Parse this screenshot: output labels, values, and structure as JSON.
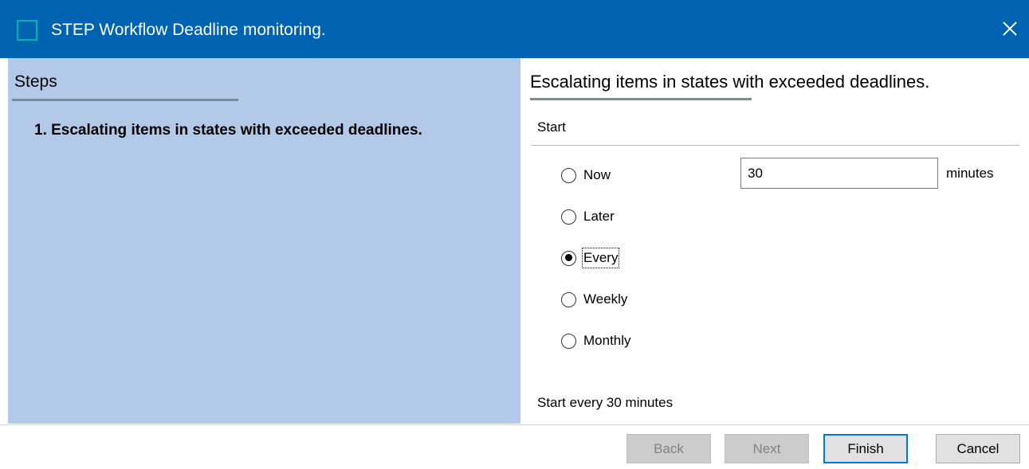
{
  "window": {
    "title": "STEP Workflow Deadline monitoring.",
    "icon": "app-icon",
    "close_icon": "close-icon"
  },
  "steps": {
    "title": "Steps",
    "items": [
      {
        "label": "1. Escalating items in states with exceeded deadlines."
      }
    ]
  },
  "content": {
    "title": "Escalating items in states with exceeded deadlines.",
    "section_label": "Start",
    "options": [
      {
        "label": "Now",
        "checked": false
      },
      {
        "label": "Later",
        "checked": false
      },
      {
        "label": "Every",
        "checked": true
      },
      {
        "label": "Weekly",
        "checked": false
      },
      {
        "label": "Monthly",
        "checked": false
      }
    ],
    "interval_value": "30",
    "interval_unit": "minutes",
    "summary": "Start every 30 minutes"
  },
  "buttons": {
    "back": "Back",
    "next": "Next",
    "finish": "Finish",
    "cancel": "Cancel"
  },
  "colors": {
    "titlebar": "#0063b1",
    "steps_panel": "#b3c9e8",
    "default_button_border": "#0078d7"
  }
}
